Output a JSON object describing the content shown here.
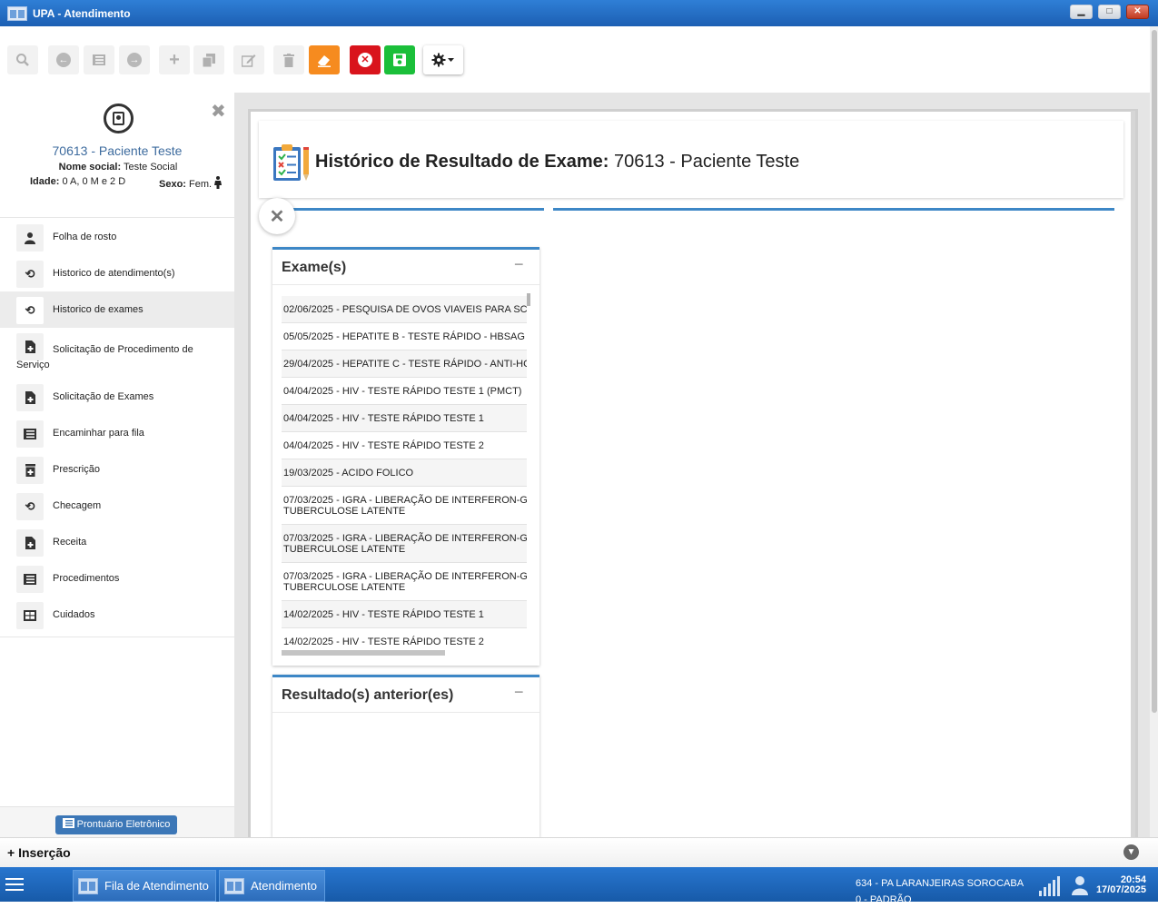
{
  "window": {
    "title": "UPA - Atendimento",
    "minimize": "▁",
    "maximize": "□",
    "close": "✕"
  },
  "toolbar": {
    "icons": [
      "search-icon",
      "arrow-left-icon",
      "list-icon",
      "arrow-right-icon",
      "plus-icon",
      "copy-icon",
      "edit-icon",
      "trash-icon",
      "eraser-icon",
      "cancel-icon",
      "save-icon",
      "gear-icon"
    ],
    "colors": {
      "eraser": "#f68b1f",
      "cancel": "#d9141c",
      "save": "#1bbf3a"
    }
  },
  "patient": {
    "name": "70613 - Paciente Teste",
    "social_label": "Nome social:",
    "social_value": "Teste Social",
    "age_label": "Idade:",
    "age_value": "0 A, 0 M e 2 D",
    "sex_label": "Sexo:",
    "sex_value": "Fem."
  },
  "sidebar": {
    "items": [
      {
        "label": "Folha de rosto",
        "icon": "user-icon"
      },
      {
        "label": "Historico de atendimento(s)",
        "icon": "history-icon"
      },
      {
        "label": "Historico de exames",
        "icon": "history-icon"
      },
      {
        "label": "Solicitação de Procedimento de",
        "label2": "Serviço",
        "icon": "file-plus-icon"
      },
      {
        "label": "Solicitação de Exames",
        "icon": "file-plus-icon"
      },
      {
        "label": "Encaminhar para fila",
        "icon": "list-icon"
      },
      {
        "label": "Prescrição",
        "icon": "prescription-icon"
      },
      {
        "label": "Checagem",
        "icon": "history-icon"
      },
      {
        "label": "Receita",
        "icon": "file-plus-icon"
      },
      {
        "label": "Procedimentos",
        "icon": "list-icon"
      },
      {
        "label": "Cuidados",
        "icon": "table-icon"
      }
    ],
    "footer_button": "Prontuário Eletrônico"
  },
  "header": {
    "title_bold": "Histórico de Resultado de Exame:",
    "title_rest": " 70613 - Paciente Teste"
  },
  "exams": {
    "title": "Exame(s)",
    "collapse": "−",
    "items": [
      {
        "line1": "02/06/2025 - PESQUISA DE OVOS VIAVEIS PARA SC",
        "line2": ""
      },
      {
        "line1": "05/05/2025 - HEPATITE B - TESTE RÁPIDO - HBSAG",
        "line2": ""
      },
      {
        "line1": "29/04/2025 - HEPATITE C - TESTE RÁPIDO - ANTI-HC",
        "line2": ""
      },
      {
        "line1": "04/04/2025 - HIV - TESTE RÁPIDO TESTE 1 (PMCT)",
        "line2": ""
      },
      {
        "line1": "04/04/2025 - HIV - TESTE RÁPIDO TESTE 1",
        "line2": ""
      },
      {
        "line1": "04/04/2025 - HIV - TESTE RÁPIDO TESTE 2",
        "line2": ""
      },
      {
        "line1": "19/03/2025 - ACIDO FOLICO",
        "line2": ""
      },
      {
        "line1": "07/03/2025 - IGRA - LIBERAÇÃO DE INTERFERON-G",
        "line2": "TUBERCULOSE LATENTE"
      },
      {
        "line1": "07/03/2025 - IGRA - LIBERAÇÃO DE INTERFERON-G",
        "line2": "TUBERCULOSE LATENTE"
      },
      {
        "line1": "07/03/2025 - IGRA - LIBERAÇÃO DE INTERFERON-G",
        "line2": "TUBERCULOSE LATENTE"
      },
      {
        "line1": "14/02/2025 - HIV - TESTE RÁPIDO TESTE 1",
        "line2": ""
      },
      {
        "line1": "14/02/2025 - HIV - TESTE RÁPIDO TESTE 2",
        "line2": ""
      }
    ]
  },
  "results": {
    "title": "Resultado(s) anterior(es)",
    "collapse": "−"
  },
  "insertion": {
    "label": "Inserção"
  },
  "taskbar": {
    "tasks": [
      "Fila de Atendimento",
      "Atendimento"
    ],
    "unit_line1": "634 - PA LARANJEIRAS SOROCABA",
    "unit_line2": "0 - PADRÃO",
    "time": "20:54",
    "date": "17/07/2025"
  }
}
